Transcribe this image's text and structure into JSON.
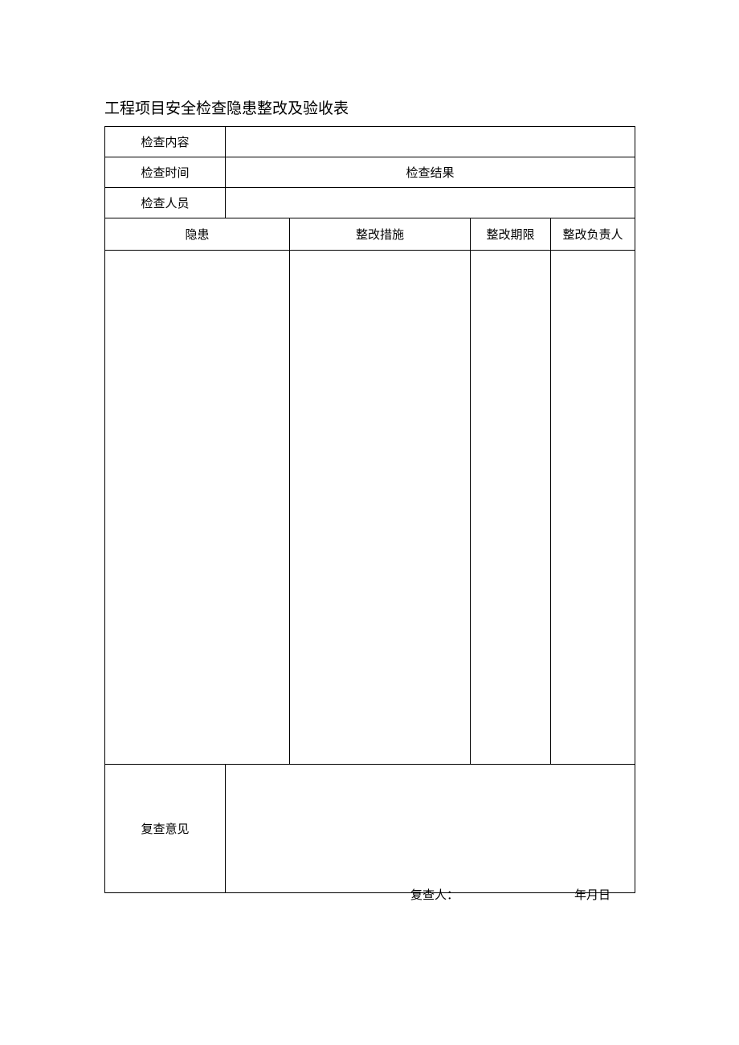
{
  "title": "工程项目安全检查隐患整改及验收表",
  "rows": {
    "check_content_label": "检查内容",
    "check_content_value": "",
    "check_time_label": "检查时间",
    "check_result_label": "检查结果",
    "check_person_label": "检查人员",
    "check_person_value": ""
  },
  "headers": {
    "hazard": "隐患",
    "measure": "整改措施",
    "deadline": "整改期限",
    "responsible": "整改负责人"
  },
  "body": {
    "hazard": "",
    "measure": "",
    "deadline": "",
    "responsible": ""
  },
  "review": {
    "label": "复查意见",
    "signer_label": "复查人：",
    "date_label": "年月日"
  }
}
